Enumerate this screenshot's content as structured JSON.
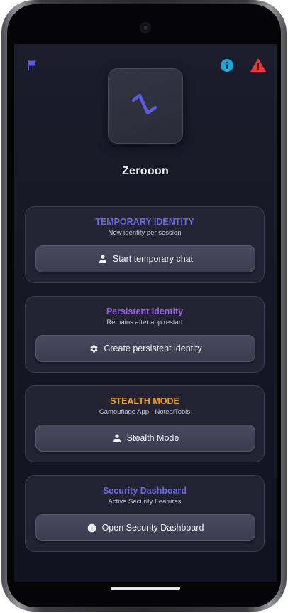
{
  "app": {
    "title": "Zerooon"
  },
  "top_bar": {
    "left_icon": "flag-icon",
    "right_icons": [
      "info-icon",
      "warning-icon"
    ]
  },
  "cards": [
    {
      "title": "TEMPORARY IDENTITY",
      "subtitle": "New identity per session",
      "button_label": "Start temporary chat",
      "button_icon": "person-icon",
      "title_color": "#6a6ae8"
    },
    {
      "title": "Persistent Identity",
      "subtitle": "Remains after app restart",
      "button_label": "Create persistent identity",
      "button_icon": "gear-icon",
      "title_color": "#9a5ee8"
    },
    {
      "title": "STEALTH MODE",
      "subtitle": "Camouflage App - Notes/Tools",
      "button_label": "Stealth Mode",
      "button_icon": "person-icon",
      "title_color": "#f2a018"
    },
    {
      "title": "Security Dashboard",
      "subtitle": "Active Security Features",
      "button_label": "Open Security Dashboard",
      "button_icon": "info-icon",
      "title_color": "#6a6ae8"
    }
  ],
  "colors": {
    "accent": "#5c5ce0",
    "info": "#20a8d8",
    "warning": "#e83a3a",
    "background": "#161624"
  }
}
